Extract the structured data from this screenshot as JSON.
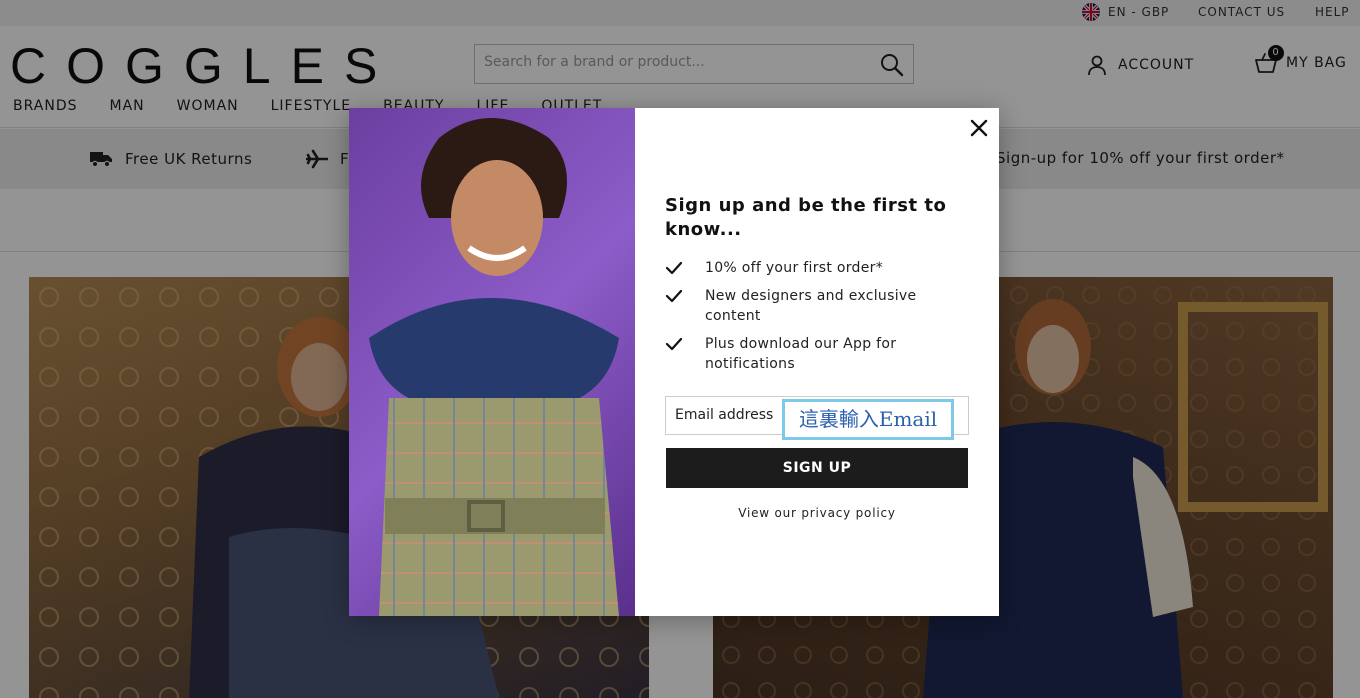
{
  "utility_bar": {
    "locale": "EN - GBP",
    "contact": "CONTACT US",
    "help": "HELP"
  },
  "header": {
    "logo": "COGGLES",
    "search_placeholder": "Search for a brand or product...",
    "account_label": "ACCOUNT",
    "bag_label": "MY BAG",
    "bag_count": "0"
  },
  "nav": [
    "BRANDS",
    "MAN",
    "WOMAN",
    "LIFESTYLE",
    "BEAUTY",
    "LIFE",
    "OUTLET"
  ],
  "promo": {
    "returns": "Free UK Returns",
    "shipping_partial": "Fr",
    "signup": "Sign-up for 10% off your first order*"
  },
  "modal": {
    "title": "Sign up and be the first to know...",
    "benefits": [
      "10% off your first order*",
      "New designers and exclusive content",
      "Plus download our App for notifications"
    ],
    "email_placeholder": "Email address",
    "email_annotation": "這裏輸入Email",
    "signup_button": "SIGN UP",
    "privacy_link": "View our privacy policy"
  },
  "colors": {
    "accent_dark": "#1c1c1c",
    "annotation_border": "#7ec9ea",
    "annotation_text": "#2b5fb0"
  }
}
